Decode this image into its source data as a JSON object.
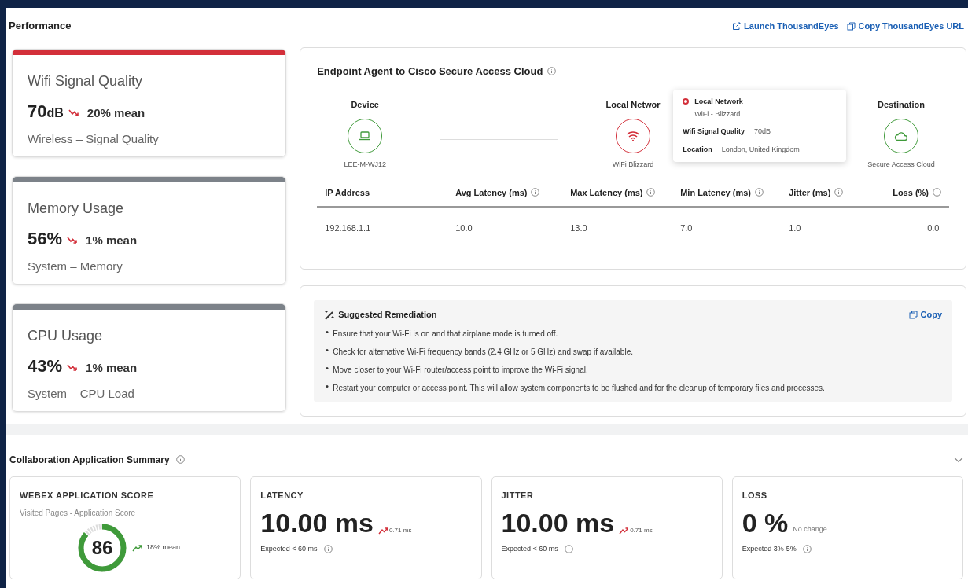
{
  "performance": {
    "title": "Performance",
    "links": [
      {
        "kind": "launch",
        "label": "Launch ThousandEyes"
      },
      {
        "kind": "copy",
        "label": "Copy ThousandEyes URL"
      }
    ],
    "metric_cards": [
      {
        "title": "Wifi Signal Quality",
        "value": "70",
        "unit": "dB",
        "trend": {
          "kind": "down",
          "text": "20% mean",
          "color": "#d32f3a"
        },
        "subtitle": "Wireless – Signal Quality",
        "color": "#d32f3a"
      },
      {
        "title": "Memory Usage",
        "value": "56%",
        "trend": {
          "kind": "down",
          "text": "1% mean",
          "color": "#d32f3a"
        },
        "subtitle": "System – Memory",
        "color": "#7c8289"
      },
      {
        "title": "CPU Usage",
        "value": "43%",
        "trend": {
          "kind": "down",
          "text": "1% mean",
          "color": "#d32f3a"
        },
        "subtitle": "System – CPU Load",
        "color": "#7c8289"
      }
    ],
    "path": {
      "title": "Endpoint Agent to Cisco Secure Access Cloud",
      "nodes": [
        {
          "kind": "laptop",
          "label": "Device",
          "caption": "LEE-M-WJ12",
          "color": "#3f9a3a"
        },
        {
          "kind": "wifi",
          "label": "Local Networ",
          "caption": "WiFi Blizzard",
          "color": "#d32f3a"
        },
        {
          "kind": "cloud",
          "label": "Destination",
          "caption": "Secure Access Cloud",
          "color": "#3f9a3a"
        }
      ],
      "tooltip": {
        "title": "Local Network",
        "subtitle": "WiFi - Blizzard",
        "color": "#d32f3a",
        "fields": [
          {
            "label": "Wifi Signal Quality",
            "value": "70dB"
          },
          {
            "label": "Location",
            "value": "London, United Kingdom"
          }
        ]
      },
      "table": {
        "columns": [
          {
            "label": "IP Address",
            "info": false
          },
          {
            "label": "Avg Latency (ms)",
            "info": true
          },
          {
            "label": "Max Latency (ms)",
            "info": true
          },
          {
            "label": "Min Latency (ms)",
            "info": true
          },
          {
            "label": "Jitter (ms)",
            "info": true
          },
          {
            "label": "Loss (%)",
            "info": true
          }
        ],
        "rows": [
          [
            "192.168.1.1",
            "10.0",
            "13.0",
            "7.0",
            "1.0",
            "0.0"
          ]
        ]
      }
    },
    "remediation": {
      "title": "Suggested Remediation",
      "copy": "Copy",
      "items": [
        "Ensure that your Wi-Fi is on and that airplane mode is turned off.",
        "Check for alternative Wi-Fi frequency bands (2.4 GHz or 5 GHz) and swap if available.",
        "Move closer to your Wi-Fi router/access point to improve the Wi-Fi signal.",
        "Restart your computer or access point. This will allow system components to be flushed and for the cleanup of temporary files and processes."
      ]
    }
  },
  "collaboration": {
    "title": "Collaboration Application Summary",
    "expanded": true,
    "cards": [
      {
        "kind": "score",
        "title": "WEBEX APPLICATION SCORE",
        "subtitle": "Visited Pages - Application Score",
        "value": "86",
        "level": 0.86,
        "color": "#3f9a3a",
        "trend": {
          "kind": "up",
          "text": "18% mean",
          "color": "#3f9a3a"
        }
      },
      {
        "kind": "metric",
        "title": "LATENCY",
        "value": "10.00 ms",
        "trend": {
          "kind": "up",
          "text": "0.71 ms",
          "color": "#d32f3a"
        },
        "expected": "Expected < 60 ms"
      },
      {
        "kind": "metric",
        "title": "JITTER",
        "value": "10.00 ms",
        "trend": {
          "kind": "up",
          "text": "0.71 ms",
          "color": "#d32f3a"
        },
        "expected": "Expected < 60 ms"
      },
      {
        "kind": "metric",
        "title": "LOSS",
        "value": "0 %",
        "trend": {
          "kind": "flat",
          "text": "No change"
        },
        "expected": "Expected 3%-5%"
      }
    ]
  }
}
